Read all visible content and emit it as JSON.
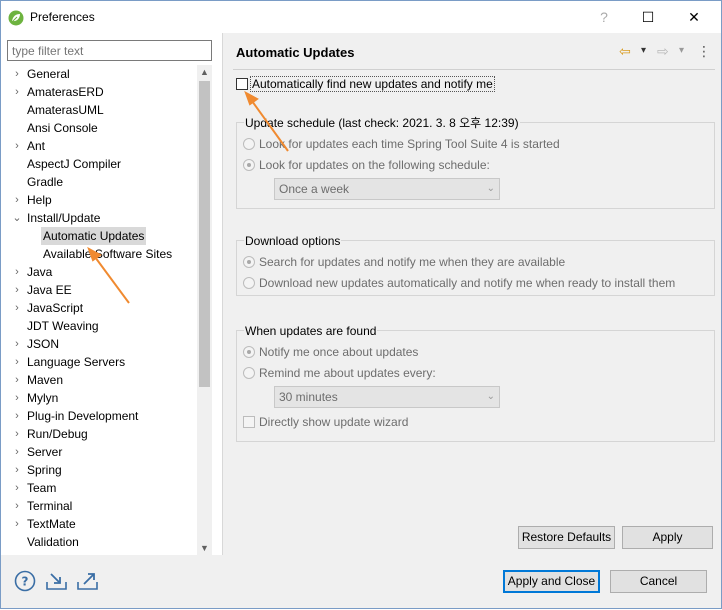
{
  "window": {
    "title": "Preferences",
    "controls": {
      "help": "?",
      "minimize": "—",
      "maximize": "☐",
      "close": "✕"
    }
  },
  "filter": {
    "placeholder": "type filter text",
    "value": ""
  },
  "tree": [
    {
      "label": "General",
      "expandable": true,
      "indent": 0
    },
    {
      "label": "AmaterasERD",
      "expandable": true,
      "indent": 0
    },
    {
      "label": "AmaterasUML",
      "expandable": false,
      "indent": 0
    },
    {
      "label": "Ansi Console",
      "expandable": false,
      "indent": 0
    },
    {
      "label": "Ant",
      "expandable": true,
      "indent": 0
    },
    {
      "label": "AspectJ Compiler",
      "expandable": false,
      "indent": 0
    },
    {
      "label": "Gradle",
      "expandable": false,
      "indent": 0
    },
    {
      "label": "Help",
      "expandable": true,
      "indent": 0
    },
    {
      "label": "Install/Update",
      "expandable": true,
      "expanded": true,
      "indent": 0
    },
    {
      "label": "Automatic Updates",
      "expandable": false,
      "indent": 1,
      "selected": true
    },
    {
      "label": "Available Software Sites",
      "expandable": false,
      "indent": 1
    },
    {
      "label": "Java",
      "expandable": true,
      "indent": 0
    },
    {
      "label": "Java EE",
      "expandable": true,
      "indent": 0
    },
    {
      "label": "JavaScript",
      "expandable": true,
      "indent": 0
    },
    {
      "label": "JDT Weaving",
      "expandable": false,
      "indent": 0
    },
    {
      "label": "JSON",
      "expandable": true,
      "indent": 0
    },
    {
      "label": "Language Servers",
      "expandable": true,
      "indent": 0
    },
    {
      "label": "Maven",
      "expandable": true,
      "indent": 0
    },
    {
      "label": "Mylyn",
      "expandable": true,
      "indent": 0
    },
    {
      "label": "Plug-in Development",
      "expandable": true,
      "indent": 0
    },
    {
      "label": "Run/Debug",
      "expandable": true,
      "indent": 0
    },
    {
      "label": "Server",
      "expandable": true,
      "indent": 0
    },
    {
      "label": "Spring",
      "expandable": true,
      "indent": 0
    },
    {
      "label": "Team",
      "expandable": true,
      "indent": 0
    },
    {
      "label": "Terminal",
      "expandable": true,
      "indent": 0
    },
    {
      "label": "TextMate",
      "expandable": true,
      "indent": 0
    },
    {
      "label": "Validation",
      "expandable": false,
      "indent": 0
    }
  ],
  "page": {
    "title": "Automatic Updates",
    "nav": {
      "back": "⇦",
      "back_menu": "▾",
      "forward": "⇨",
      "forward_menu": "▾",
      "more": "⋮"
    },
    "auto_find": {
      "label": "Automatically find new updates and notify me",
      "checked": false
    },
    "schedule": {
      "title": "Update schedule (last check: 2021. 3. 8 오후 12:39)",
      "option_startup": "Look for updates each time Spring Tool Suite 4 is started",
      "option_schedule": "Look for updates on the following schedule:",
      "selected": "schedule",
      "interval": "Once a week"
    },
    "download": {
      "title": "Download options",
      "option_search": "Search for updates and notify me when they are available",
      "option_auto": "Download new updates automatically and notify me when ready to install them",
      "selected": "search"
    },
    "found": {
      "title": "When updates are found",
      "option_once": "Notify me once about updates",
      "option_remind": "Remind me about updates every:",
      "selected": "once",
      "remind_interval": "30 minutes",
      "wizard_label": "Directly show update wizard",
      "wizard_checked": false
    },
    "restore_defaults": "Restore Defaults",
    "apply": "Apply"
  },
  "footer": {
    "apply_close": "Apply and Close",
    "cancel": "Cancel",
    "icons": [
      "help-icon",
      "import-icon",
      "export-icon"
    ]
  },
  "colors": {
    "accent": "#0078d7",
    "annotation_arrow": "#f08a30",
    "window_bg": "#f0f0f0"
  }
}
